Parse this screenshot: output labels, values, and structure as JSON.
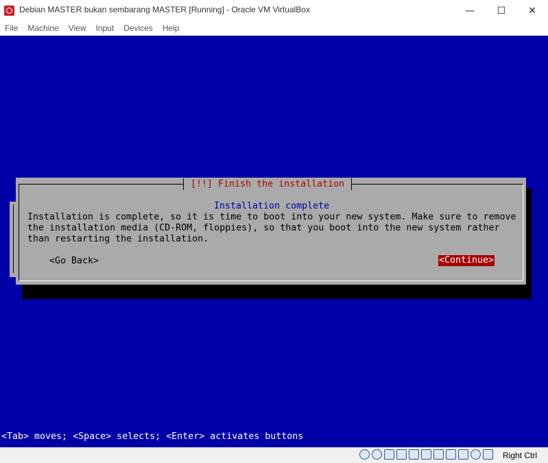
{
  "window": {
    "title": "Debian MASTER bukan sembarang MASTER [Running] - Oracle VM VirtualBox",
    "minimize_glyph": "—",
    "maximize_glyph": "☐",
    "close_glyph": "✕"
  },
  "menu": [
    "File",
    "Machine",
    "View",
    "Input",
    "Devices",
    "Help"
  ],
  "installer": {
    "dialog_title": "[!!] Finish the installation",
    "heading": "Installation complete",
    "message": "Installation is complete, so it is time to boot into your new system. Make sure to remove\nthe installation media (CD-ROM, floppies), so that you boot into the new system rather\nthan restarting the installation.",
    "go_back_label": "<Go Back>",
    "continue_label": "<Continue>",
    "help_line": "<Tab> moves; <Space> selects; <Enter> activates buttons"
  },
  "status_bar": {
    "icons": [
      "hard-disk-icon",
      "optical-drive-icon",
      "audio-icon",
      "network-icon",
      "usb-icon",
      "shared-folders-icon",
      "display-icon",
      "video-capture-icon",
      "cpu-icon",
      "mouse-integration-icon",
      "keyboard-icon"
    ],
    "host_key_label": "Right Ctrl"
  },
  "colors": {
    "installer_background": "#0000a8",
    "dialog_background": "#aaaaaa",
    "title_red": "#a80000",
    "heading_blue": "#0000a8",
    "selected_button": "#a80000"
  }
}
